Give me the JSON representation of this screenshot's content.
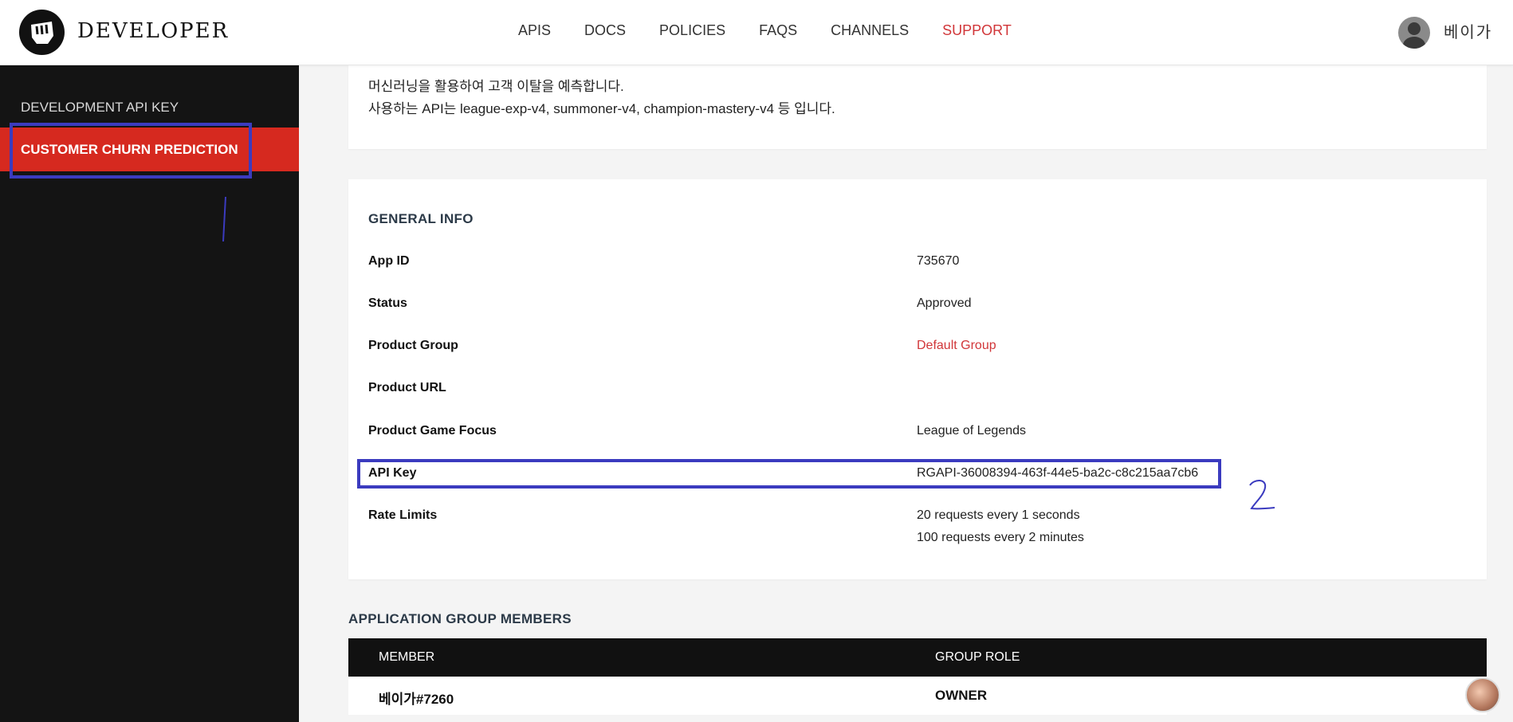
{
  "header": {
    "logo_text": "DEVELOPER",
    "nav": [
      "APIS",
      "DOCS",
      "POLICIES",
      "FAQS",
      "CHANNELS",
      "SUPPORT"
    ],
    "username": "베이가"
  },
  "sidebar": {
    "items": [
      {
        "label": "DEVELOPMENT API KEY"
      },
      {
        "label": "CUSTOMER CHURN PREDICTION"
      }
    ]
  },
  "description": {
    "line1": "머신러닝을 활용하여 고객 이탈을 예측합니다.",
    "line2": "사용하는 API는 league-exp-v4, summoner-v4, champion-mastery-v4 등 입니다."
  },
  "general_info": {
    "title": "GENERAL INFO",
    "app_id_label": "App ID",
    "app_id_value": "735670",
    "status_label": "Status",
    "status_value": "Approved",
    "product_group_label": "Product Group",
    "product_group_value": "Default Group",
    "product_url_label": "Product URL",
    "product_url_value": "",
    "game_focus_label": "Product Game Focus",
    "game_focus_value": "League of Legends",
    "api_key_label": "API Key",
    "api_key_value": "RGAPI-36008394-463f-44e5-ba2c-c8c215aa7cb6",
    "rate_limits_label": "Rate Limits",
    "rate_limit_1": "20 requests every 1 seconds",
    "rate_limit_2": "100 requests every 2 minutes"
  },
  "members": {
    "title": "APPLICATION GROUP MEMBERS",
    "col_member": "MEMBER",
    "col_role": "GROUP ROLE",
    "rows": [
      {
        "member": "베이가#7260",
        "role": "OWNER"
      }
    ]
  },
  "annotations": {
    "one": "1",
    "two": "2"
  },
  "colors": {
    "accent_red": "#d6291f",
    "annotation_blue": "#3b3bbf",
    "sidebar_bg": "#141414"
  }
}
